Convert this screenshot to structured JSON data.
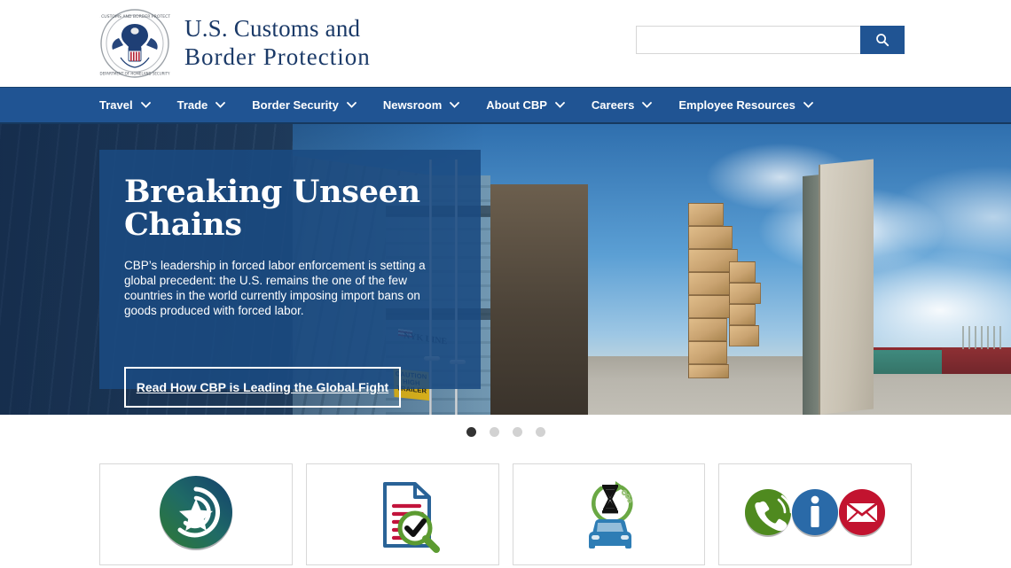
{
  "header": {
    "agency_name_line1": "U.S. Customs and",
    "agency_name_line2": "Border Protection",
    "seal_alt": "cbp-seal",
    "search": {
      "value": "",
      "placeholder": "",
      "button_icon": "search-icon"
    }
  },
  "nav": {
    "items": [
      {
        "label": "Travel",
        "icon": "chevron-down-icon"
      },
      {
        "label": "Trade",
        "icon": "chevron-down-icon"
      },
      {
        "label": "Border Security",
        "icon": "chevron-down-icon"
      },
      {
        "label": "Newsroom",
        "icon": "chevron-down-icon"
      },
      {
        "label": "About CBP",
        "icon": "chevron-down-icon"
      },
      {
        "label": "Careers",
        "icon": "chevron-down-icon"
      },
      {
        "label": "Employee Resources",
        "icon": "chevron-down-icon"
      }
    ]
  },
  "hero": {
    "title": "Breaking Unseen Chains",
    "description": "CBP’s leadership in forced labor enforcement is setting a global precedent: the U.S. remains the one of the few countries in the world currently imposing import bans on goods produced with forced labor.",
    "cta_label": "Read How CBP is Leading the Global Fight",
    "image_caption_text": {
      "caution_sign": "CAUTION HIGH TRAILER",
      "container_mark": "NYK LINE"
    }
  },
  "carousel": {
    "slide_count": 4,
    "active_index": 0,
    "dots": [
      "slide-1",
      "slide-2",
      "slide-3",
      "slide-4"
    ]
  },
  "cards": [
    {
      "name": "trusted-traveler-programs",
      "icon": "star-shield-icon"
    },
    {
      "name": "forms-and-documents",
      "icon": "document-search-check-icon"
    },
    {
      "name": "border-wait-times",
      "icon": "car-hourglass-icon"
    },
    {
      "name": "contact-us",
      "icon": "phone-info-email-icon"
    }
  ],
  "colors": {
    "nav_blue": "#205493",
    "brand_navy": "#1b3a68",
    "panel_blue": "#1a4a81",
    "accent_green": "#4a8b2c",
    "accent_red": "#b32033",
    "dot_active": "#333333",
    "dot_inactive": "#d2d2d2"
  }
}
